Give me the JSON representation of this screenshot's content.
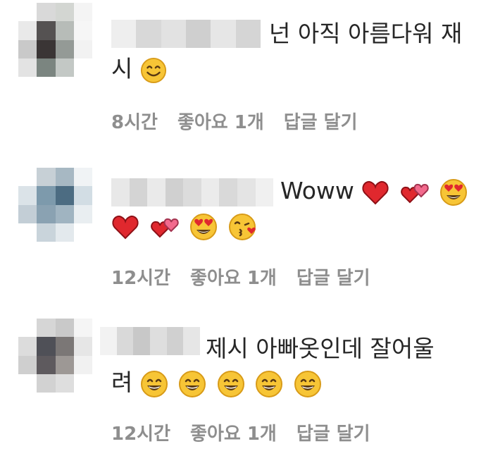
{
  "comments": [
    {
      "text1": "넌 아직 아름다워 재",
      "text2": "시",
      "time": "8시간",
      "likes": "좋아요 1개",
      "reply": "답글 달기",
      "avatar_colors": [
        "#ffffff",
        "#d9d9d9",
        "#d3d6d2",
        "#f4f4f4",
        "#e9e9e9",
        "#555252",
        "#b7bcb8",
        "#f6f6f6",
        "#c9c9c9",
        "#3a3535",
        "#949a96",
        "#f2f2f2",
        "#e3e3e3",
        "#7b8580",
        "#c3c8c5",
        "#ffffff"
      ],
      "name_colors": [
        "#eeeeee",
        "#d8d8d8",
        "#e2e2e2",
        "#cfcfcf",
        "#e6e6e6",
        "#d5d5d5"
      ]
    },
    {
      "text1": "Woww",
      "time": "12시간",
      "likes": "좋아요 1개",
      "reply": "답글 달기",
      "avatar_colors": [
        "#ffffff",
        "#c7d0d6",
        "#a7b8c3",
        "#f0f3f5",
        "#dbe3e8",
        "#7d9aac",
        "#4c6c82",
        "#d2dde4",
        "#c3ced6",
        "#8aa2b2",
        "#a0b4c1",
        "#e9eef1",
        "#ffffff",
        "#c9d4db",
        "#e3e9ed",
        "#ffffff"
      ],
      "name_colors": [
        "#e8e8e8",
        "#d4d4d4",
        "#eaeaea",
        "#d0d0d0",
        "#dcdcdc",
        "#ebebeb",
        "#d9d9d9",
        "#e4e4e4",
        "#f0f0f0"
      ]
    },
    {
      "text1": "제시 아빠옷인데 잘어울",
      "text2": "려",
      "time": "12시간",
      "likes": "좋아요 1개",
      "reply": "답글 달기",
      "avatar_colors": [
        "#ffffff",
        "#d6d6d6",
        "#c9c9c9",
        "#f5f5f5",
        "#dcdcdc",
        "#4f5057",
        "#7b7776",
        "#e6e6e6",
        "#cfcfcf",
        "#5e5a5e",
        "#9d9895",
        "#f1f1f1",
        "#ffffff",
        "#d2d2d2",
        "#dedede",
        "#ffffff"
      ],
      "name_colors": [
        "#f2f2f2",
        "#d9d9d9",
        "#c8c8c8",
        "#dedede",
        "#d0d0d0",
        "#e6e6e6"
      ]
    }
  ]
}
